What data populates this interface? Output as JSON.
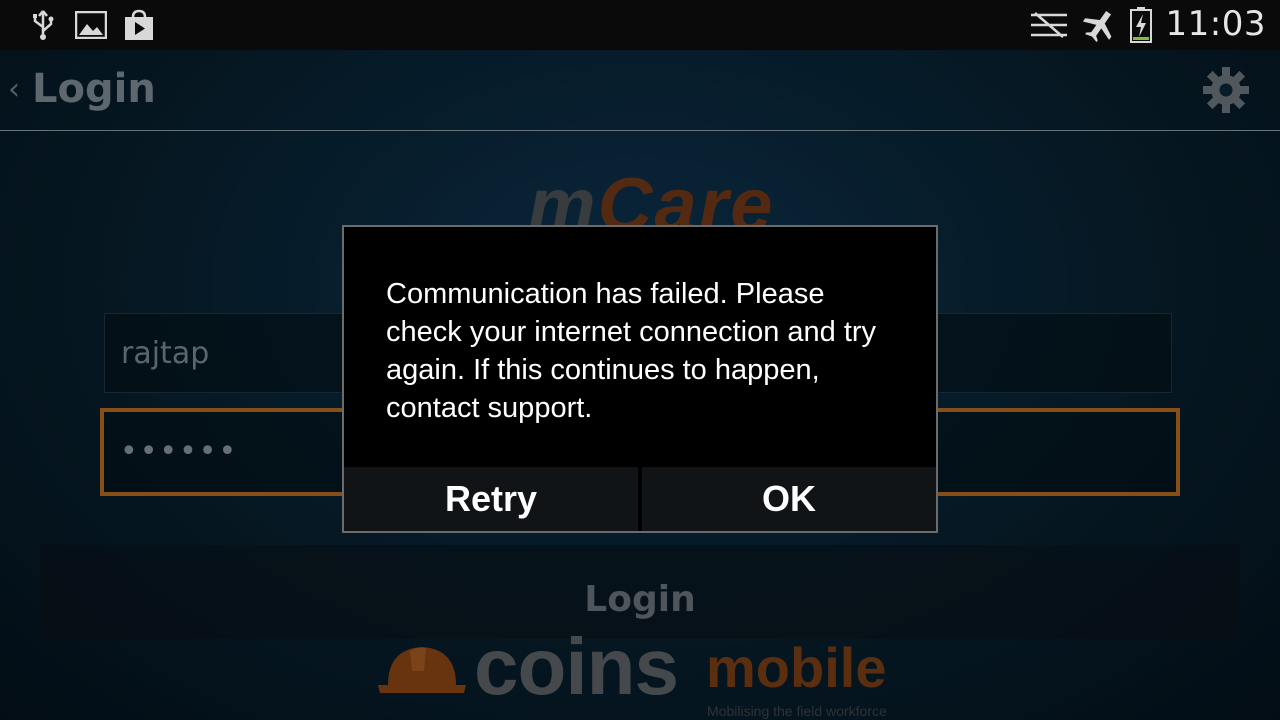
{
  "status_bar": {
    "time": "11:03",
    "left_icons": [
      "usb-icon",
      "image-icon",
      "play-store-icon"
    ],
    "right_icons": [
      "no-sim-icon",
      "airplane-mode-icon",
      "battery-charging-icon"
    ]
  },
  "app_bar": {
    "title": "Login",
    "back_icon": "chevron-left-icon",
    "settings_icon": "gear-icon"
  },
  "brand": {
    "mcare_m": "m",
    "mcare_rest": "Care"
  },
  "form": {
    "username_value": "rajtap",
    "password_value": "••••••",
    "login_button": "Login"
  },
  "footer_logo": {
    "coins": "COINS",
    "mobile": "mobile",
    "tagline": "Mobilising the field workforce"
  },
  "dialog": {
    "message": "Communication has failed. Please check your internet connection and try again. If this continues to happen, contact support.",
    "retry_label": "Retry",
    "ok_label": "OK"
  },
  "colors": {
    "accent_orange": "#b46a1e",
    "brand_brown": "#7a3e14",
    "dialog_bg": "#000000"
  }
}
